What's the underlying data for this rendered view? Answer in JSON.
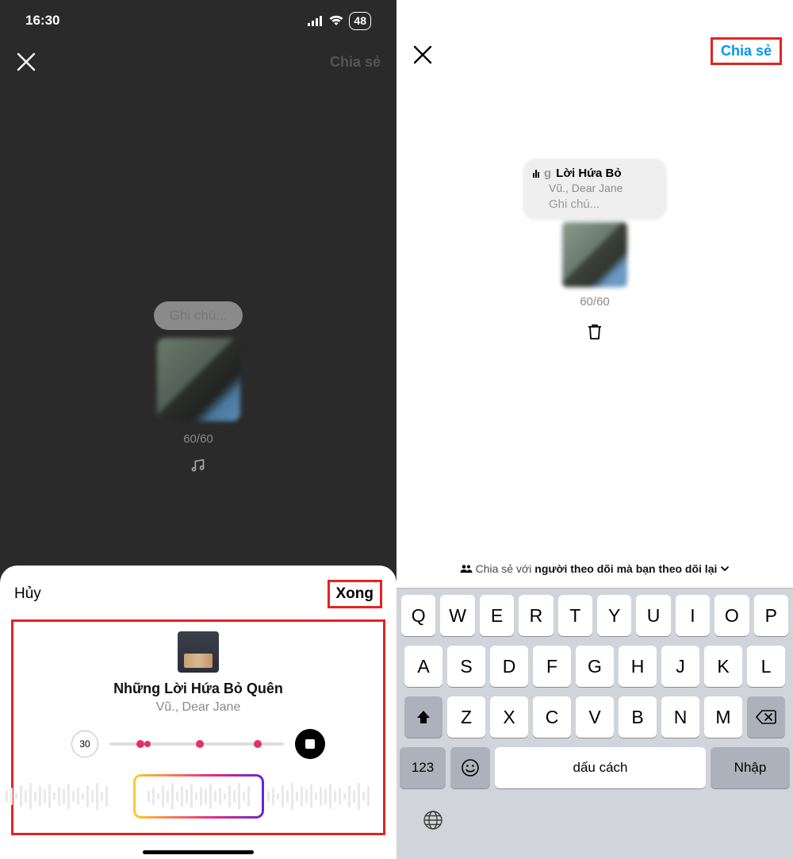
{
  "left": {
    "status": {
      "time": "16:30",
      "battery": "48"
    },
    "topbar": {
      "share_dim": "Chia sẻ"
    },
    "center": {
      "note_placeholder": "Ghi chú...",
      "count": "60/60"
    },
    "sheet": {
      "cancel": "Hủy",
      "done": "Xong",
      "song_title": "Những Lời Hứa Bỏ Quên",
      "song_artist": "Vũ., Dear Jane",
      "duration": "30"
    }
  },
  "right": {
    "share_btn": "Chia sẻ",
    "card": {
      "grey_prefix": "g",
      "title": "Lời Hứa Bỏ",
      "artist": "Vũ., Dear Jane",
      "note": "Ghi chú..."
    },
    "count": "60/60",
    "sharewith": {
      "pre": "Chia sẻ với",
      "bold": "người theo dõi mà bạn theo dõi lại"
    },
    "keyboard": {
      "row1": [
        "Q",
        "W",
        "E",
        "R",
        "T",
        "Y",
        "U",
        "I",
        "O",
        "P"
      ],
      "row2": [
        "A",
        "S",
        "D",
        "F",
        "G",
        "H",
        "J",
        "K",
        "L"
      ],
      "row3": [
        "Z",
        "X",
        "C",
        "V",
        "B",
        "N",
        "M"
      ],
      "num": "123",
      "space": "dấu cách",
      "enter": "Nhập"
    }
  }
}
